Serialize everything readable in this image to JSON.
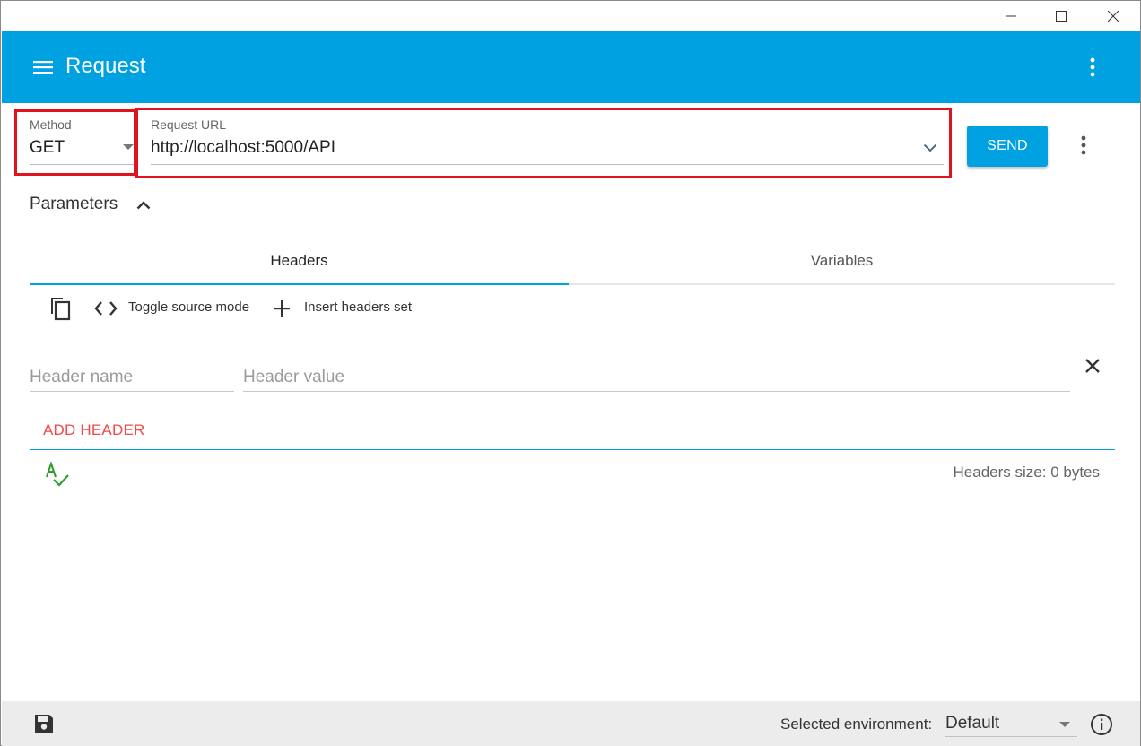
{
  "app": {
    "title": "Request"
  },
  "icons": {
    "menu": "hamburger-menu-icon",
    "more": "more-vert-icon",
    "method_dropdown": "triangle-down-icon",
    "url_dropdown": "chevron-down-icon",
    "params_toggle": "chevron-up-icon",
    "copy": "copy-icon",
    "code": "code-icon",
    "add": "plus-icon",
    "remove": "close-icon",
    "spellcheck": "spellcheck-icon",
    "save": "save-icon",
    "info": "info-icon"
  },
  "colors": {
    "accent": "#00a1e0",
    "highlight_border": "#e0141e",
    "add_header_text": "#ef4a4a",
    "spellcheck_green": "#2e9b2e"
  },
  "request": {
    "method_label": "Method",
    "method_value": "GET",
    "url_label": "Request URL",
    "url_value": "http://localhost:5000/API",
    "send_label": "SEND"
  },
  "parameters": {
    "title": "Parameters",
    "tabs": [
      {
        "label": "Headers",
        "active": true
      },
      {
        "label": "Variables",
        "active": false
      }
    ],
    "toolbar": {
      "toggle_source_label": "Toggle source mode",
      "insert_headers_label": "Insert headers set"
    },
    "header_row": {
      "name_placeholder": "Header name",
      "value_placeholder": "Header value",
      "name_value": "",
      "value_value": ""
    },
    "add_header_label": "ADD HEADER",
    "headers_size": "Headers size: 0 bytes"
  },
  "footer": {
    "env_label": "Selected environment:",
    "env_value": "Default"
  }
}
